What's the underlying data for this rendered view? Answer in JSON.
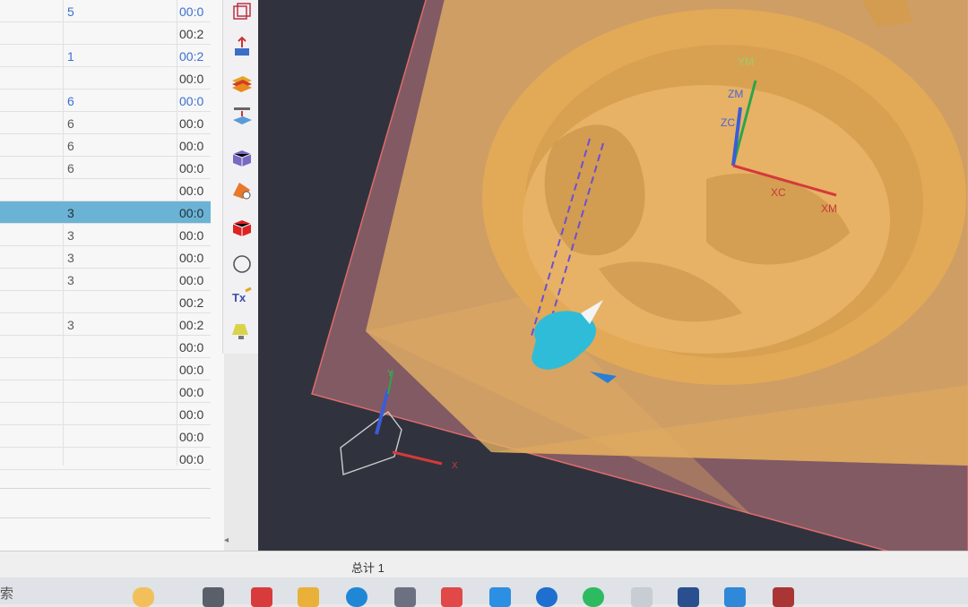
{
  "table": {
    "rows": [
      {
        "c1": "5",
        "c2": "00:0",
        "c1_blue": true,
        "c2_blue": true,
        "selected": false
      },
      {
        "c1": "",
        "c2": "00:2",
        "c1_blue": false,
        "c2_blue": false,
        "selected": false
      },
      {
        "c1": "1",
        "c2": "00:2",
        "c1_blue": true,
        "c2_blue": true,
        "selected": false
      },
      {
        "c1": "",
        "c2": "00:0",
        "c1_blue": false,
        "c2_blue": false,
        "selected": false
      },
      {
        "c1": "6",
        "c2": "00:0",
        "c1_blue": true,
        "c2_blue": true,
        "selected": false
      },
      {
        "c1": "6",
        "c2": "00:0",
        "c1_blue": false,
        "c2_blue": false,
        "selected": false
      },
      {
        "c1": "6",
        "c2": "00:0",
        "c1_blue": false,
        "c2_blue": false,
        "selected": false
      },
      {
        "c1": "6",
        "c2": "00:0",
        "c1_blue": false,
        "c2_blue": false,
        "selected": false
      },
      {
        "c1": "",
        "c2": "00:0",
        "c1_blue": false,
        "c2_blue": false,
        "selected": false
      },
      {
        "c1": "3",
        "c2": "00:0",
        "c1_blue": false,
        "c2_blue": false,
        "selected": true
      },
      {
        "c1": "3",
        "c2": "00:0",
        "c1_blue": false,
        "c2_blue": false,
        "selected": false
      },
      {
        "c1": "3",
        "c2": "00:0",
        "c1_blue": false,
        "c2_blue": false,
        "selected": false
      },
      {
        "c1": "3",
        "c2": "00:0",
        "c1_blue": false,
        "c2_blue": false,
        "selected": false
      },
      {
        "c1": "",
        "c2": "00:2",
        "c1_blue": false,
        "c2_blue": false,
        "selected": false
      },
      {
        "c1": "3",
        "c2": "00:2",
        "c1_blue": false,
        "c2_blue": false,
        "selected": false
      },
      {
        "c1": "",
        "c2": "00:0",
        "c1_blue": false,
        "c2_blue": false,
        "selected": false
      },
      {
        "c1": "",
        "c2": "00:0",
        "c1_blue": false,
        "c2_blue": false,
        "selected": false
      },
      {
        "c1": "",
        "c2": "00:0",
        "c1_blue": false,
        "c2_blue": false,
        "selected": false
      },
      {
        "c1": "",
        "c2": "00:0",
        "c1_blue": false,
        "c2_blue": false,
        "selected": false
      },
      {
        "c1": "",
        "c2": "00:0",
        "c1_blue": false,
        "c2_blue": false,
        "selected": false
      },
      {
        "c1": "",
        "c2": "00:0",
        "c1_blue": false,
        "c2_blue": false,
        "selected": false
      }
    ]
  },
  "toolbar": {
    "icons": [
      "wireframe-cube-icon",
      "move-up-icon",
      "layers-icon",
      "raise-layer-icon",
      "box-edges-icon",
      "orange-shape-icon",
      "red-cube-icon",
      "circle-icon",
      "tool-text-icon",
      "lamp-icon"
    ]
  },
  "viewport": {
    "axis_labels": {
      "ym": "YM",
      "zm": "ZM",
      "zc": "ZC",
      "xc": "XC",
      "xm": "XM",
      "y": "Y",
      "x": "X"
    }
  },
  "status": {
    "text": "总计 1"
  },
  "taskbar": {
    "search_text": "索",
    "apps": [
      "weather-icon",
      "window-icon",
      "acrobat-icon",
      "folder-icon",
      "edge-icon",
      "chart-icon",
      "red-app-icon",
      "blue-app-icon",
      "k-app-icon",
      "green-app-icon",
      "gray-app-icon",
      "v-app-icon",
      "blue2-app-icon",
      "red2-app-icon"
    ]
  },
  "colors": {
    "selected_row": "#6bb3d4",
    "model": "#e8b565",
    "viewport_bg": "#30333d",
    "stock_box": "#c77a84"
  }
}
